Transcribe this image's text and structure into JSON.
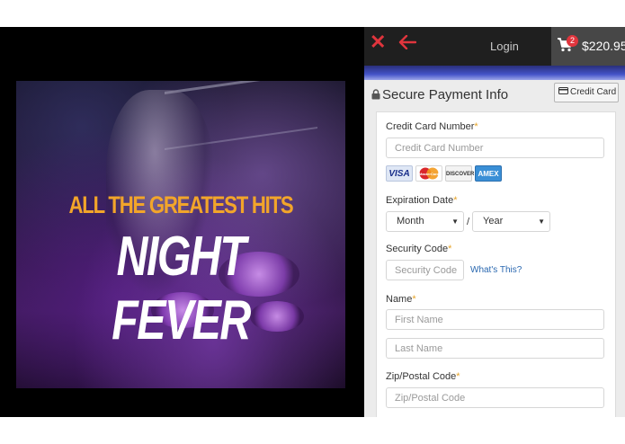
{
  "video": {
    "subtitle": "ALL THE GREATEST HITS",
    "title": "NIGHT FEVER"
  },
  "topbar": {
    "close_icon": "x-icon",
    "back_icon": "arrow-left-icon",
    "login_label": "Login",
    "cart_count": "2",
    "cart_total": "$220.95",
    "accent_color": "#e0353d"
  },
  "section": {
    "title": "Secure Payment Info",
    "tab_label": "Credit Card"
  },
  "form": {
    "card_number": {
      "label": "Credit Card Number",
      "placeholder": "Credit Card Number"
    },
    "card_logos": [
      "VISA",
      "MasterCard",
      "DISCOVER",
      "AMEX"
    ],
    "expiration": {
      "label": "Expiration Date",
      "month": "Month",
      "separator": "/",
      "year": "Year"
    },
    "security": {
      "label": "Security Code",
      "placeholder": "Security Code",
      "help_link": "What's This?"
    },
    "name": {
      "label": "Name",
      "first_placeholder": "First Name",
      "last_placeholder": "Last Name"
    },
    "zip": {
      "label": "Zip/Postal Code",
      "placeholder": "Zip/Postal Code"
    },
    "required_mark": "*"
  }
}
